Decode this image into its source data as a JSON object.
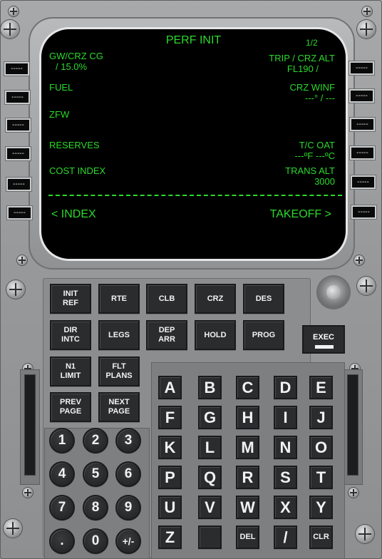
{
  "screen": {
    "title": "PERF INIT",
    "page": "1/2",
    "left": [
      {
        "label": "GW/CRZ CG",
        "value": " / 15.0%"
      },
      {
        "label": "FUEL",
        "value": ""
      },
      {
        "label": "ZFW",
        "value": ""
      },
      {
        "label": "RESERVES",
        "value": ""
      },
      {
        "label": "COST INDEX",
        "value": ""
      }
    ],
    "right": [
      {
        "label": "TRIP / CRZ ALT",
        "value": "FL190 /"
      },
      {
        "label": "CRZ WINF",
        "value": "---° / ---"
      },
      {
        "label": "",
        "value": ""
      },
      {
        "label": "T/C OAT",
        "value": "---ºF ---ºC"
      },
      {
        "label": "TRANS ALT",
        "value": "3000"
      }
    ],
    "bottom_left": "< INDEX",
    "bottom_right": "TAKEOFF >"
  },
  "lsk_label": "-----",
  "function_keys": {
    "init_ref": [
      "INIT",
      "REF"
    ],
    "rte": [
      "RTE"
    ],
    "clb": [
      "CLB"
    ],
    "crz": [
      "CRZ"
    ],
    "des": [
      "DES"
    ],
    "dir_intc": [
      "DIR",
      "INTC"
    ],
    "legs": [
      "LEGS"
    ],
    "dep_arr": [
      "DEP",
      "ARR"
    ],
    "hold": [
      "HOLD"
    ],
    "prog": [
      "PROG"
    ],
    "n1_limit": [
      "N1",
      "LIMIT"
    ],
    "flt_plans": [
      "FLT",
      "PLANS"
    ],
    "prev_page": [
      "PREV",
      "PAGE"
    ],
    "next_page": [
      "NEXT",
      "PAGE"
    ]
  },
  "exec_label": "EXEC",
  "alpha_keys": [
    "A",
    "B",
    "C",
    "D",
    "E",
    "F",
    "G",
    "H",
    "I",
    "J",
    "K",
    "L",
    "M",
    "N",
    "O",
    "P",
    "Q",
    "R",
    "S",
    "T",
    "U",
    "V",
    "W",
    "X",
    "Y",
    "Z",
    "",
    "DEL",
    "/",
    "CLR"
  ],
  "num_keys": [
    "1",
    "2",
    "3",
    "4",
    "5",
    "6",
    "7",
    "8",
    "9",
    ".",
    "0",
    "+/-"
  ]
}
